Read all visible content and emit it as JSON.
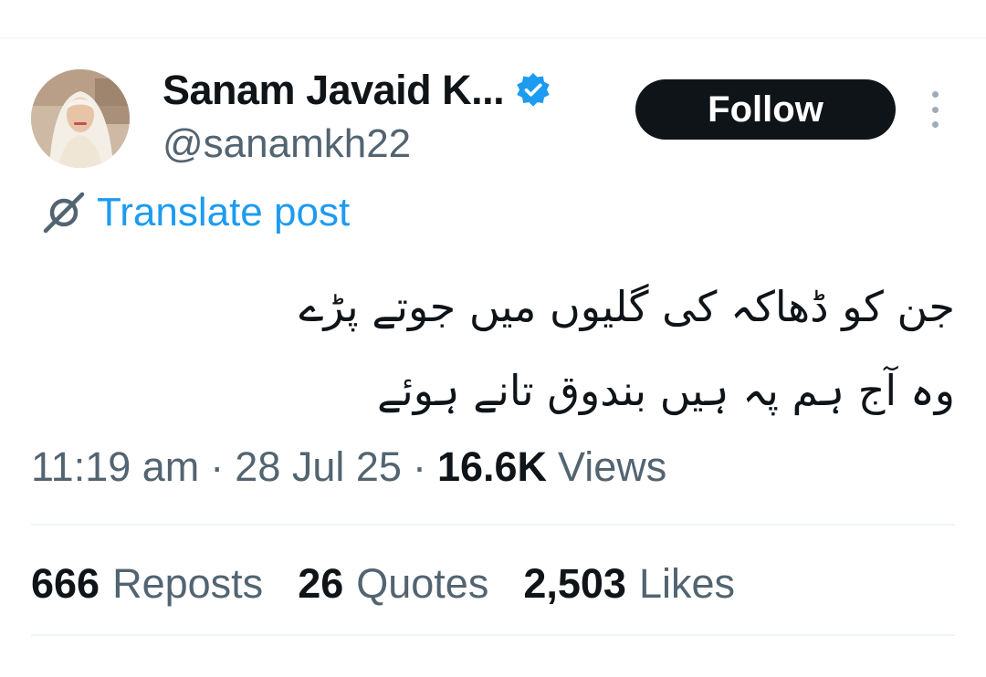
{
  "author": {
    "display_name": "Sanam Javaid K...",
    "handle": "@sanamkh22",
    "verified": true,
    "verified_color": "#1d9bf0"
  },
  "actions": {
    "follow_label": "Follow",
    "more_icon": "more-vertical-icon"
  },
  "translate": {
    "label": "Translate post",
    "icon": "translate-icon"
  },
  "post": {
    "lines": [
      "جن کو ڈھاکہ کی گلیوں میں جوتے پڑے",
      "وہ آج ہم پہ ہیں بندوق تانے ہوئے"
    ]
  },
  "meta": {
    "time": "11:19 am",
    "separator": "·",
    "date": "28 Jul 25",
    "views_count": "16.6K",
    "views_label": "Views"
  },
  "stats": {
    "reposts_count": "666",
    "reposts_label": "Reposts",
    "quotes_count": "26",
    "quotes_label": "Quotes",
    "likes_count": "2,503",
    "likes_label": "Likes"
  },
  "colors": {
    "text_primary": "#0f1419",
    "text_secondary": "#536471",
    "accent": "#1d9bf0",
    "divider": "#eff3f4"
  }
}
